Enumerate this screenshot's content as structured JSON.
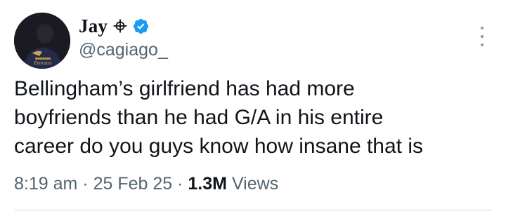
{
  "author": {
    "display_name": "Jay",
    "handle": "@cagiago_",
    "name_emoji_icon": "crosshair-icon",
    "verified_icon": "verified-badge-icon",
    "verified_color": "#1d9bf0",
    "avatar_jersey_text": "Emirates"
  },
  "post": {
    "text_lines": [
      "Bellingham’s girlfriend has had more",
      "boyfriends than he had G/A in his entire",
      "career do you guys know how insane that is"
    ]
  },
  "meta": {
    "time": "8:19 am",
    "separator": "·",
    "date": "25 Feb 25",
    "views_count": "1.3M",
    "views_label": "Views"
  },
  "actions": {
    "more_icon": "more-vertical-icon"
  }
}
